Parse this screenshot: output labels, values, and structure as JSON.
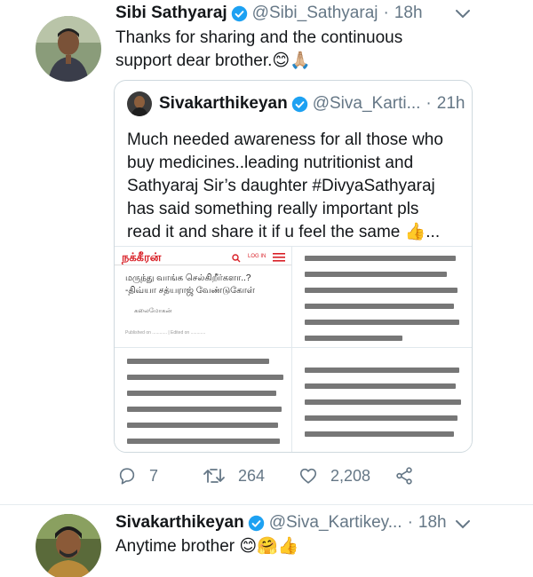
{
  "tweet1": {
    "name": "Sibi Sathyaraj",
    "handle": "@Sibi_Sathyaraj",
    "separator": "·",
    "time": "18h",
    "text_line1": "Thanks for sharing and the continuous",
    "text_line2": "support  dear brother.😊🙏🏼",
    "quote": {
      "name": "Sivakarthikeyan",
      "handle": "@Siva_Karti...",
      "separator": "·",
      "time": "21h",
      "lines": [
        "Much needed awareness for all those who",
        "buy medicines..leading nutritionist and",
        "Sathyaraj Sir’s daughter #DivyaSathyaraj",
        "has said something really important pls",
        "read it and share it if u feel the same 👍..."
      ],
      "media": {
        "logo": "நக்கீரன்",
        "login": "LOG IN",
        "headline1": "மருந்து வாங்க செல்கிறீர்களா..?",
        "headline2": "-திவ்யா சத்யராஜ் வேண்டுகோள்",
        "byline": "கலைமோகன்",
        "published": "Published on ............ | Edited on ............"
      }
    },
    "actions": {
      "replies": "7",
      "retweets": "264",
      "likes": "2,208"
    }
  },
  "tweet2": {
    "name": "Sivakarthikeyan",
    "handle": "@Siva_Kartikey...",
    "separator": "·",
    "time": "18h",
    "text": "Anytime brother 😊🤗👍"
  },
  "colors": {
    "verified": "#1da1f2",
    "text": "#14171a",
    "muted": "#657786",
    "border": "#cfd9de",
    "logo_red": "#d81f26"
  },
  "icons": [
    "verified-icon",
    "chevron-down-icon",
    "reply-icon",
    "retweet-icon",
    "like-icon",
    "share-icon",
    "search-icon",
    "menu-icon"
  ]
}
